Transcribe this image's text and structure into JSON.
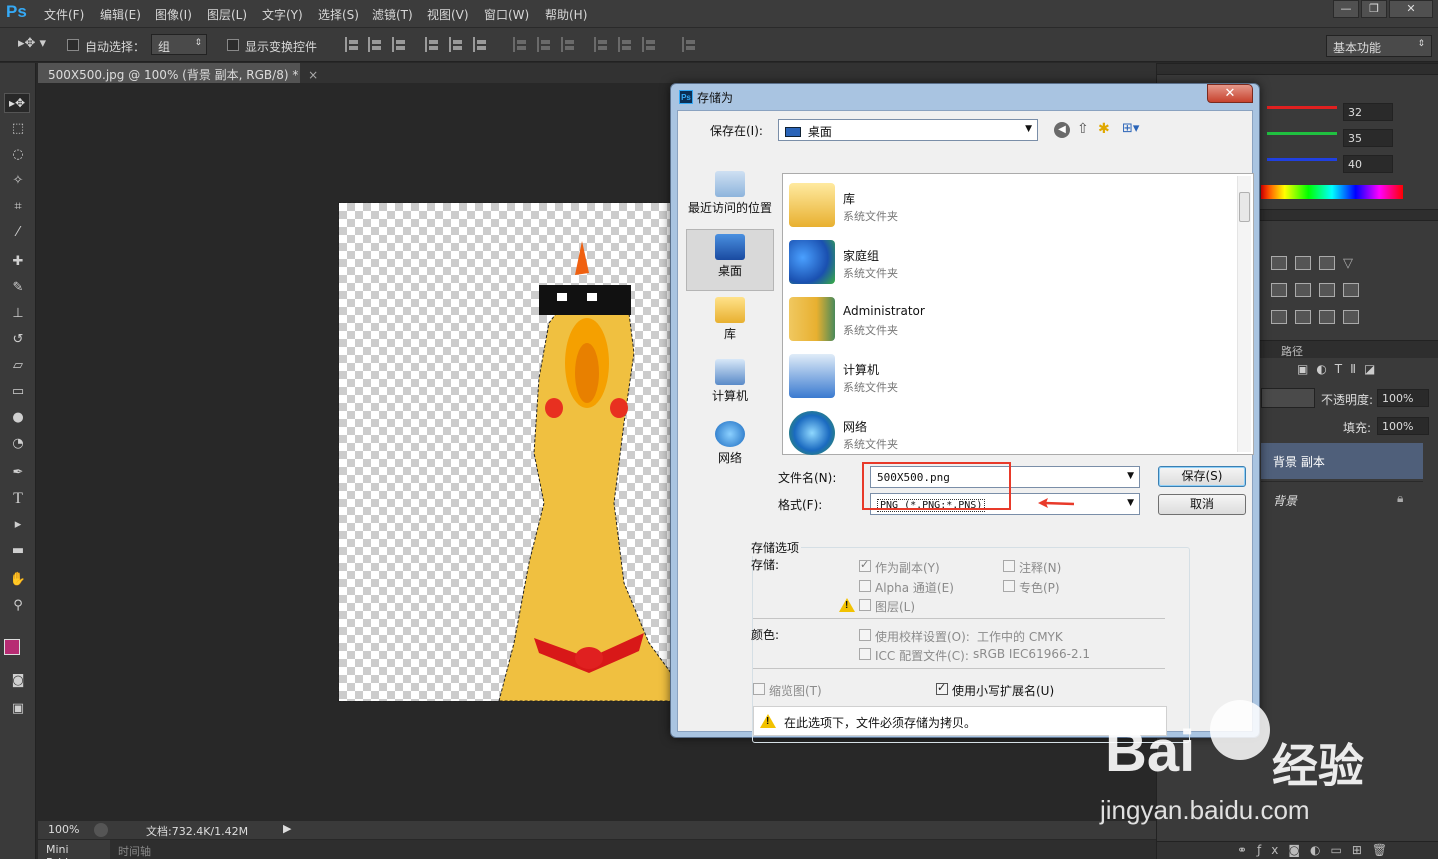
{
  "app": {
    "logo": "Ps"
  },
  "menubar": {
    "items": [
      "文件(F)",
      "编辑(E)",
      "图像(I)",
      "图层(L)",
      "文字(Y)",
      "选择(S)",
      "滤镜(T)",
      "视图(V)",
      "窗口(W)",
      "帮助(H)"
    ],
    "window_buttons": [
      "—",
      "❐",
      "✕"
    ]
  },
  "options_bar": {
    "auto_select_label": "自动选择：",
    "auto_select_value": "组",
    "show_transform_label": "显示变换控件",
    "workspace": "基本功能"
  },
  "document": {
    "tab_title": "500X500.jpg @ 100% (背景 副本, RGB/8) *"
  },
  "status_bar": {
    "zoom": "100%",
    "doc_info": "文档:732.4K/1.42M"
  },
  "bottom_tabs": [
    "Mini Bridge",
    "时间轴"
  ],
  "color_panel": {
    "r": "32",
    "g": "35",
    "b": "40",
    "colors": {
      "red": "#e02020",
      "green": "#20c040",
      "blue": "#2040e0"
    }
  },
  "layers_panel": {
    "paths_tab": "路径",
    "opacity_label": "不透明度:",
    "opacity_value": "100%",
    "fill_label": "填充:",
    "fill_value": "100%",
    "layers": [
      {
        "name": "背景 副本",
        "selected": true
      },
      {
        "name": "背景",
        "locked": true
      }
    ]
  },
  "dialog": {
    "title": "存储为",
    "save_in_label": "保存在(I):",
    "save_in_value": "桌面",
    "places": [
      {
        "label": "最近访问的位置",
        "icon": "recent-places-icon"
      },
      {
        "label": "桌面",
        "icon": "desktop-icon",
        "selected": true
      },
      {
        "label": "库",
        "icon": "libraries-icon"
      },
      {
        "label": "计算机",
        "icon": "computer-icon"
      },
      {
        "label": "网络",
        "icon": "network-icon"
      }
    ],
    "files": [
      {
        "name": "库",
        "type": "系统文件夹",
        "icon": "libraries-folder-icon"
      },
      {
        "name": "家庭组",
        "type": "系统文件夹",
        "icon": "homegroup-icon"
      },
      {
        "name": "Administrator",
        "type": "系统文件夹",
        "icon": "user-folder-icon"
      },
      {
        "name": "计算机",
        "type": "系统文件夹",
        "icon": "computer-icon"
      },
      {
        "name": "网络",
        "type": "系统文件夹",
        "icon": "network-icon"
      }
    ],
    "filename_label": "文件名(N):",
    "filename_value": "500X500.png",
    "format_label": "格式(F):",
    "format_value": "PNG (*.PNG;*.PNS)",
    "save_button": "保存(S)",
    "cancel_button": "取消",
    "options_title": "存储选项",
    "save_label": "存储:",
    "opt_as_copy": "作为副本(Y)",
    "opt_notes": "注释(N)",
    "opt_alpha": "Alpha 通道(E)",
    "opt_spot": "专色(P)",
    "opt_layers": "图层(L)",
    "color_label": "颜色:",
    "opt_proof": "使用校样设置(O):",
    "opt_proof_value": "工作中的 CMYK",
    "opt_icc": "ICC 配置文件(C):",
    "opt_icc_value": "sRGB IEC61966-2.1",
    "opt_thumbnail": "缩览图(T)",
    "opt_lowercase": "使用小写扩展名(U)",
    "warning_text": "在此选项下，文件必须存储为拷贝。"
  },
  "watermark": {
    "brand": "Bai",
    "brand_cn": "经验",
    "url": "jingyan.baidu.com"
  }
}
